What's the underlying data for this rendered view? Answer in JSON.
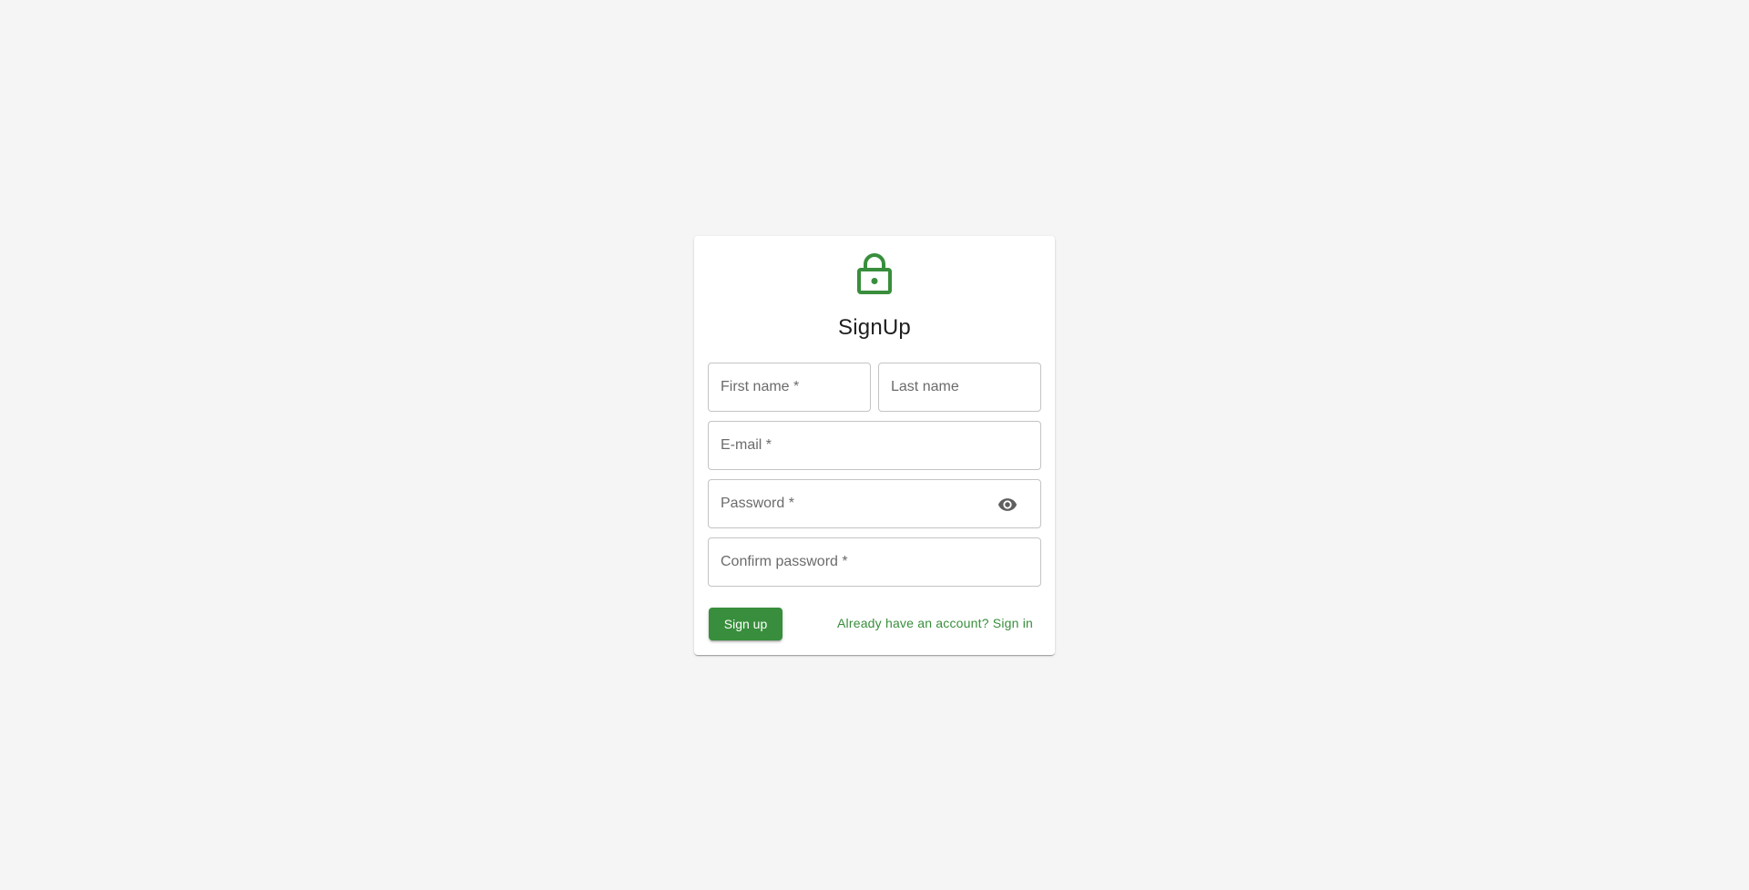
{
  "form": {
    "title": "SignUp",
    "icon": "lock-icon",
    "accent_color": "#388e3c",
    "fields": {
      "first_name": {
        "placeholder": "First name *",
        "value": ""
      },
      "last_name": {
        "placeholder": "Last name",
        "value": ""
      },
      "email": {
        "placeholder": "E-mail *",
        "value": ""
      },
      "password": {
        "placeholder": "Password *",
        "value": "",
        "toggle_icon": "eye-icon"
      },
      "confirm_password": {
        "placeholder": "Confirm password *",
        "value": ""
      }
    },
    "submit_label": "Sign up",
    "signin_link": "Already have an account? Sign in"
  }
}
